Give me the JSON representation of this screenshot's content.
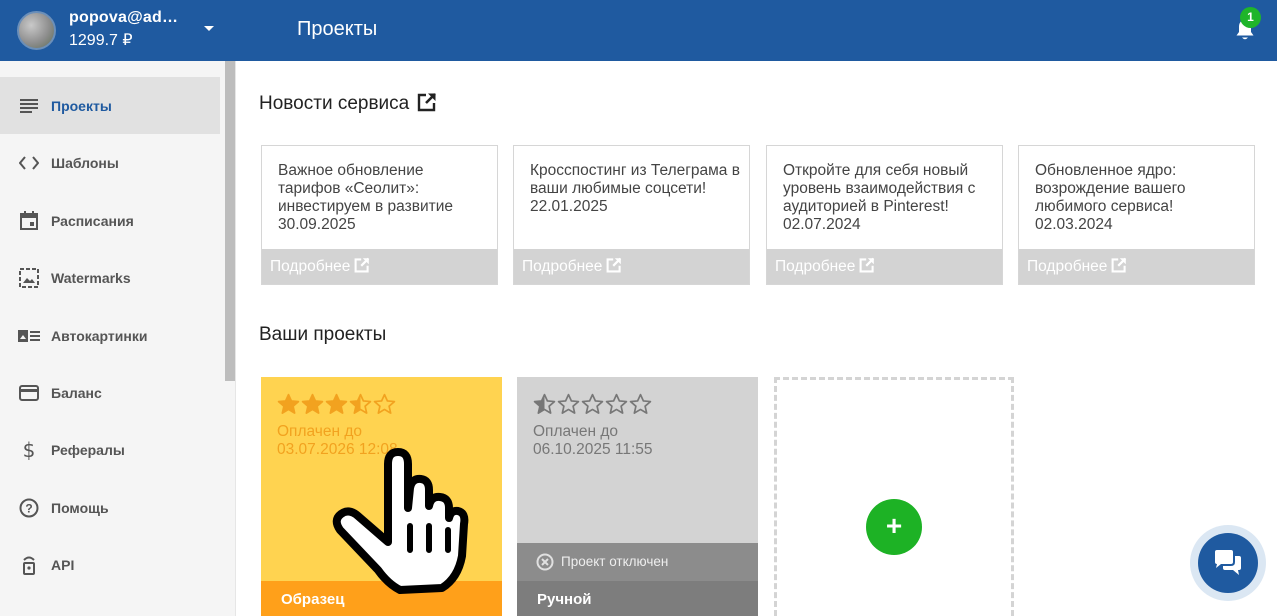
{
  "header": {
    "user_email": "popova@ad…",
    "user_balance": "1299.7 ₽",
    "page_title": "Проекты",
    "notification_count": "1"
  },
  "sidebar": {
    "items": [
      {
        "label": "Проекты",
        "icon": "list-icon",
        "active": true
      },
      {
        "label": "Шаблоны",
        "icon": "code-icon"
      },
      {
        "label": "Расписания",
        "icon": "calendar-icon"
      },
      {
        "label": "Watermarks",
        "icon": "watermark-icon"
      },
      {
        "label": "Автокартинки",
        "icon": "image-text-icon"
      },
      {
        "label": "Баланс",
        "icon": "credit-card-icon"
      },
      {
        "label": "Рефералы",
        "icon": "dollar-icon"
      },
      {
        "label": "Помощь",
        "icon": "help-icon"
      },
      {
        "label": "API",
        "icon": "api-icon"
      }
    ]
  },
  "news": {
    "title": "Новости сервиса",
    "more_label": "Подробнее",
    "items": [
      {
        "text": "Важное обновление тарифов «Сеолит»: инвестируем в развитие",
        "date": "30.09.2025"
      },
      {
        "text": "Кросспостинг из Телеграма в ваши любимые соцсети!",
        "date": "22.01.2025"
      },
      {
        "text": "Откройте для себя новый уровень взаимодействия с аудиторией в Pinterest!",
        "date": "02.07.2024"
      },
      {
        "text": "Обновленное ядро: возрождение вашего любимого сервиса!",
        "date": "02.03.2024"
      }
    ]
  },
  "projects": {
    "title": "Ваши проекты",
    "items": [
      {
        "name": "Образец",
        "paid_label": "Оплачен до",
        "paid_until": "03.07.2026 12:08",
        "rating": 3.5,
        "rating_max": 5,
        "color": "#ffd350"
      },
      {
        "name": "Ручной",
        "paid_label": "Оплачен до",
        "paid_until": "06.10.2025 11:55",
        "rating": 0.5,
        "rating_max": 5,
        "status": "Проект отключен",
        "color": "#d3d3d3"
      }
    ],
    "add_label": "+"
  },
  "colors": {
    "header": "#1f5aa0",
    "accent_green": "#1db225",
    "project_yellow": "#ffd350",
    "project_orange": "#ffa01a"
  }
}
